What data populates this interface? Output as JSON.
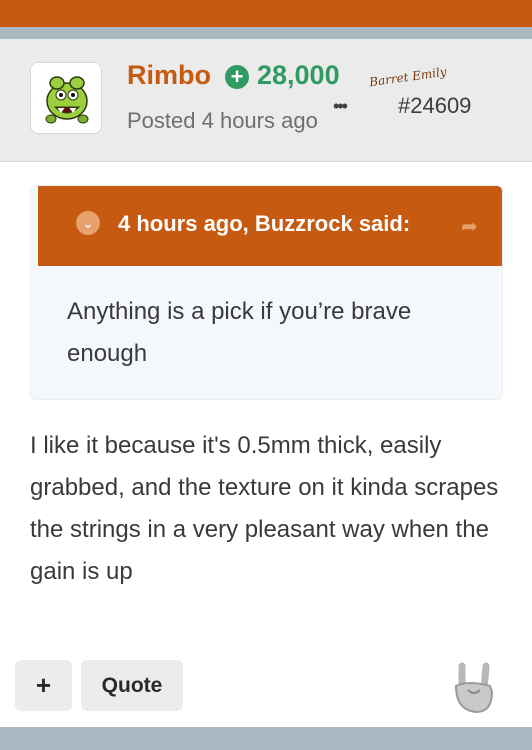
{
  "post": {
    "author": "Rimbo",
    "reputation": "28,000",
    "badge_text": "Barret Emily",
    "posted": "Posted 4 hours ago",
    "more_icon": "•••",
    "number": "#24609"
  },
  "quote": {
    "cite": "4 hours ago, Buzzrock said:",
    "text": "Anything is a pick if you’re brave enough"
  },
  "body": "I like it because it's 0.5mm thick, easily grabbed, and the texture on it kinda scrapes the strings in a very pleasant way when the gain is up",
  "actions": {
    "plus_label": "+",
    "quote_label": "Quote"
  },
  "colors": {
    "accent": "#c65a10",
    "reputation": "#2f9b63",
    "strip": "#a8b7c0"
  },
  "icons": {
    "rep": "plus-circle-icon",
    "toggle": "chevron-down-icon",
    "share": "share-arrow-icon",
    "reaction": "rock-hand-icon"
  }
}
